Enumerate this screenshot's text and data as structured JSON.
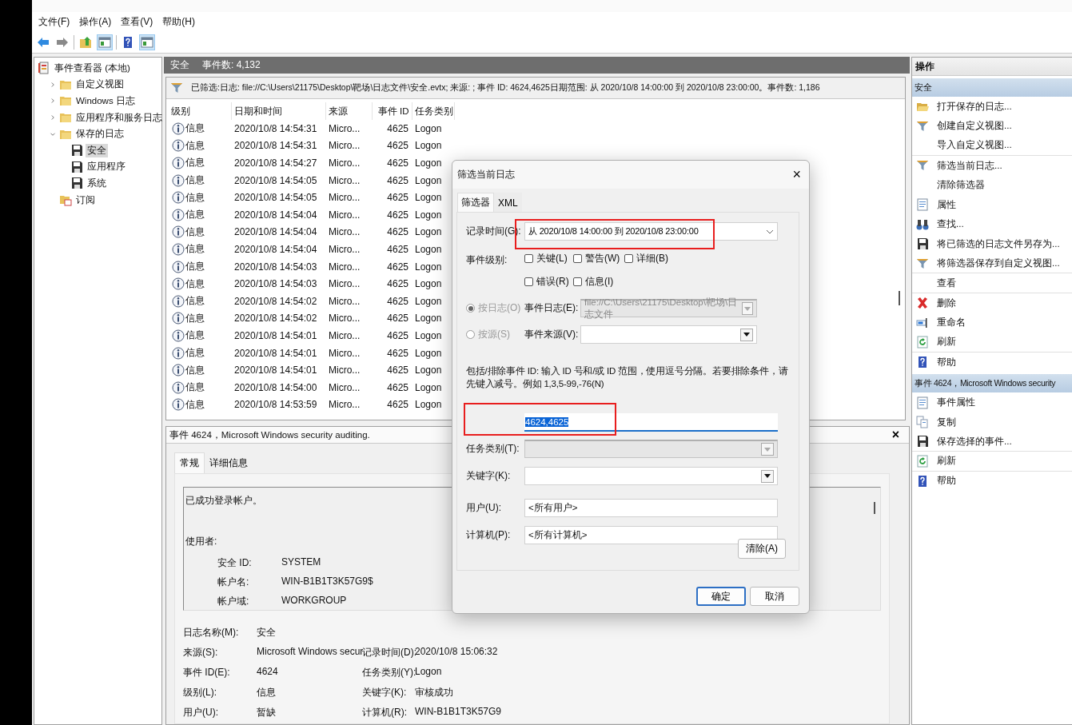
{
  "menu": [
    "文件(F)",
    "操作(A)",
    "查看(V)",
    "帮助(H)"
  ],
  "toolbar": [
    {
      "kind": "back",
      "pressed": false
    },
    {
      "kind": "forward",
      "pressed": false
    },
    {
      "kind": "up",
      "pressed": false
    },
    {
      "kind": "pane",
      "pressed": true
    },
    {
      "kind": "help",
      "pressed": false
    },
    {
      "kind": "pane",
      "pressed": true
    }
  ],
  "tree": [
    {
      "label": "事件查看器 (本地)",
      "kind": "root",
      "selected": false,
      "children": [
        {
          "label": "自定义视图",
          "kind": "folder",
          "expanded": false,
          "selected": false
        },
        {
          "label": "Windows 日志",
          "kind": "folder",
          "expanded": false,
          "selected": false
        },
        {
          "label": "应用程序和服务日志",
          "kind": "folder",
          "expanded": false,
          "selected": false
        },
        {
          "label": "保存的日志",
          "kind": "folder",
          "expanded": true,
          "selected": false,
          "children": [
            {
              "label": "安全",
              "kind": "disk",
              "selected": true
            },
            {
              "label": "应用程序",
              "kind": "disk",
              "selected": false
            },
            {
              "label": "系统",
              "kind": "disk",
              "selected": false
            }
          ]
        },
        {
          "label": "订阅",
          "kind": "subscription",
          "selected": false
        }
      ]
    }
  ],
  "log_header": {
    "title": "安全",
    "count": "事件数: 4,132"
  },
  "filter_summary": "已筛选:日志: file://C:\\Users\\21175\\Desktop\\靶场\\日志文件\\安全.evtx; 来源: ; 事件 ID: 4624,4625日期范围: 从 2020/10/8 14:00:00 到 2020/10/8 23:00:00。事件数: 1,186",
  "table": {
    "columns": [
      "级别",
      "日期和时间",
      "来源",
      "事件 ID",
      "任务类别"
    ],
    "rows": [
      {
        "selected": false,
        "cells": [
          "信息",
          "2020/10/8 14:54:31",
          "Micro...",
          "4625",
          "Logon"
        ]
      },
      {
        "selected": false,
        "cells": [
          "信息",
          "2020/10/8 14:54:31",
          "Micro...",
          "4625",
          "Logon"
        ]
      },
      {
        "selected": false,
        "cells": [
          "信息",
          "2020/10/8 14:54:27",
          "Micro...",
          "4625",
          "Logon"
        ]
      },
      {
        "selected": false,
        "cells": [
          "信息",
          "2020/10/8 14:54:05",
          "Micro...",
          "4625",
          "Logon"
        ]
      },
      {
        "selected": false,
        "cells": [
          "信息",
          "2020/10/8 14:54:05",
          "Micro...",
          "4625",
          "Logon"
        ]
      },
      {
        "selected": false,
        "cells": [
          "信息",
          "2020/10/8 14:54:04",
          "Micro...",
          "4625",
          "Logon"
        ]
      },
      {
        "selected": false,
        "cells": [
          "信息",
          "2020/10/8 14:54:04",
          "Micro...",
          "4625",
          "Logon"
        ]
      },
      {
        "selected": false,
        "cells": [
          "信息",
          "2020/10/8 14:54:04",
          "Micro...",
          "4625",
          "Logon"
        ]
      },
      {
        "selected": false,
        "cells": [
          "信息",
          "2020/10/8 14:54:03",
          "Micro...",
          "4625",
          "Logon"
        ]
      },
      {
        "selected": false,
        "cells": [
          "信息",
          "2020/10/8 14:54:03",
          "Micro...",
          "4625",
          "Logon"
        ]
      },
      {
        "selected": false,
        "cells": [
          "信息",
          "2020/10/8 14:54:02",
          "Micro...",
          "4625",
          "Logon"
        ]
      },
      {
        "selected": false,
        "cells": [
          "信息",
          "2020/10/8 14:54:02",
          "Micro...",
          "4625",
          "Logon"
        ]
      },
      {
        "selected": false,
        "cells": [
          "信息",
          "2020/10/8 14:54:01",
          "Micro...",
          "4625",
          "Logon"
        ]
      },
      {
        "selected": false,
        "cells": [
          "信息",
          "2020/10/8 14:54:01",
          "Micro...",
          "4625",
          "Logon"
        ]
      },
      {
        "selected": false,
        "cells": [
          "信息",
          "2020/10/8 14:54:01",
          "Micro...",
          "4625",
          "Logon"
        ]
      },
      {
        "selected": false,
        "cells": [
          "信息",
          "2020/10/8 14:54:00",
          "Micro...",
          "4625",
          "Logon"
        ]
      },
      {
        "selected": false,
        "cells": [
          "信息",
          "2020/10/8 14:53:59",
          "Micro...",
          "4625",
          "Logon"
        ]
      }
    ]
  },
  "details": {
    "title": "事件 4624，Microsoft Windows security auditing.",
    "close": "×",
    "tabs": [
      {
        "label": "常规",
        "selected": true
      },
      {
        "label": "详细信息",
        "selected": false
      }
    ],
    "summary": "已成功登录帐户。",
    "subject_label": "使用者:",
    "fields": [
      {
        "label": "安全 ID:",
        "value": "SYSTEM"
      },
      {
        "label": "帐户名:",
        "value": "WIN-B1B1T3K57G9$"
      },
      {
        "label": "帐户域:",
        "value": "WORKGROUP"
      }
    ],
    "properties": [
      {
        "label": "日志名称(M):",
        "value": "安全"
      },
      {
        "label": "来源(S):",
        "value": "Microsoft Windows secur",
        "label2": "记录时间(D):",
        "value2": "2020/10/8 15:06:32"
      },
      {
        "label": "事件 ID(E):",
        "value": "4624",
        "label2": "任务类别(Y):",
        "value2": "Logon"
      },
      {
        "label": "级别(L):",
        "value": "信息",
        "label2": "关键字(K):",
        "value2": "审核成功"
      },
      {
        "label": "用户(U):",
        "value": "暂缺",
        "label2": "计算机(R):",
        "value2": "WIN-B1B1T3K57G9"
      }
    ]
  },
  "actions": {
    "title": "操作",
    "sections": [
      {
        "title": "安全",
        "items": [
          {
            "label": "打开保存的日志...",
            "kind": "open-folder",
            "divider": false
          },
          {
            "label": "创建自定义视图...",
            "kind": "funnel",
            "divider": false
          },
          {
            "label": "导入自定义视图...",
            "kind": "none",
            "divider": true
          },
          {
            "label": "筛选当前日志...",
            "kind": "funnel",
            "divider": false
          },
          {
            "label": "清除筛选器",
            "kind": "none",
            "divider": false
          },
          {
            "label": "属性",
            "kind": "properties",
            "divider": false
          },
          {
            "label": "查找...",
            "kind": "binoculars",
            "divider": false
          },
          {
            "label": "将已筛选的日志文件另存为...",
            "kind": "disk",
            "divider": false
          },
          {
            "label": "将筛选器保存到自定义视图...",
            "kind": "funnel",
            "divider": true
          },
          {
            "label": "查看",
            "kind": "none",
            "divider": true
          },
          {
            "label": "删除",
            "kind": "delete",
            "divider": false
          },
          {
            "label": "重命名",
            "kind": "rename",
            "divider": false
          },
          {
            "label": "刷新",
            "kind": "refresh",
            "divider": true
          },
          {
            "label": "帮助",
            "kind": "help",
            "divider": false
          }
        ]
      },
      {
        "title": "事件 4624，Microsoft Windows security",
        "items": [
          {
            "label": "事件属性",
            "kind": "properties",
            "divider": false
          },
          {
            "label": "复制",
            "kind": "copy",
            "divider": false
          },
          {
            "label": "保存选择的事件...",
            "kind": "disk",
            "divider": true
          },
          {
            "label": "刷新",
            "kind": "refresh",
            "divider": true
          },
          {
            "label": "帮助",
            "kind": "help",
            "divider": false
          }
        ]
      }
    ]
  },
  "dialog": {
    "title": "筛选当前日志",
    "close": "×",
    "tabs": [
      {
        "label": "筛选器",
        "selected": true
      },
      {
        "label": "XML",
        "selected": false
      }
    ],
    "logged": {
      "label": "记录时间(G):",
      "value": "从 2020/10/8 14:00:00 到 2020/10/8 23:00:00"
    },
    "level_label": "事件级别:",
    "levels": [
      {
        "label": "关键(L)",
        "checked": false
      },
      {
        "label": "警告(W)",
        "checked": false
      },
      {
        "label": "详细(B)",
        "checked": false
      },
      {
        "label": "错误(R)",
        "checked": false
      },
      {
        "label": "信息(I)",
        "checked": false
      }
    ],
    "sources": [
      {
        "label": "按日志(O)",
        "selected": true,
        "disabled": true,
        "field_label": "事件日志(E):",
        "value": "file://C:\\Users\\21175\\Desktop\\靶场\\日志文件",
        "field_disabled": true
      },
      {
        "label": "按源(S)",
        "selected": false,
        "disabled": true,
        "field_label": "事件来源(V):",
        "field_disabled": false
      }
    ],
    "id_hint": "包括/排除事件 ID: 输入 ID 号和/或 ID 范围，使用逗号分隔。若要排除条件，请先键入减号。例如 1,3,5-99,-76(N)",
    "ids": "4624,4625",
    "fields": [
      {
        "kind": "dropdown",
        "label": "任务类别(T):",
        "disabled": true
      },
      {
        "kind": "dropdown",
        "label": "关键字(K):",
        "disabled": false
      },
      {
        "kind": "text",
        "label": "用户(U):",
        "value": "<所有用户>"
      },
      {
        "kind": "text",
        "label": "计算机(P):",
        "value": "<所有计算机>"
      }
    ],
    "clear_button": "清除(A)",
    "buttons": [
      {
        "label": "确定",
        "default": true
      },
      {
        "label": "取消",
        "default": false
      }
    ]
  }
}
